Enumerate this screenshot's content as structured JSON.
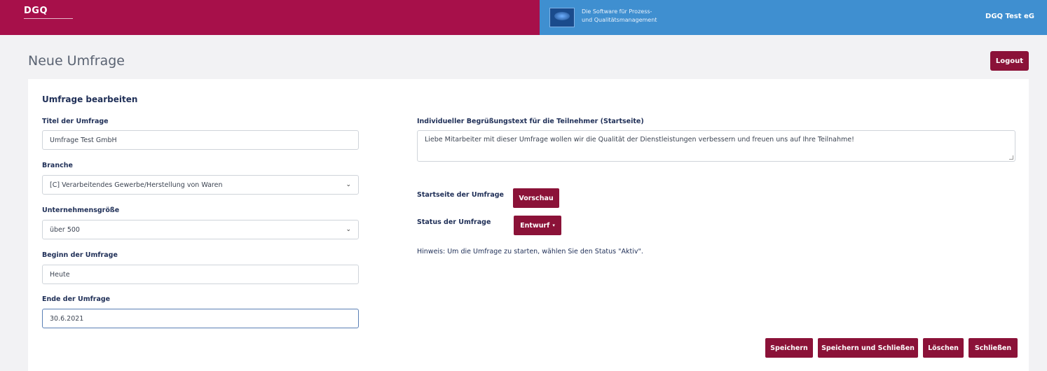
{
  "header": {
    "logo_text": "DGQ",
    "partner_line1": "Die Software für Prozess-",
    "partner_line2": "und Qualitätsmanagement",
    "company": "DGQ Test eG"
  },
  "page": {
    "title": "Neue Umfrage",
    "logout_label": "Logout"
  },
  "form": {
    "section_title": "Umfrage bearbeiten",
    "title_label": "Titel der Umfrage",
    "title_value": "Umfrage Test GmbH",
    "branch_label": "Branche",
    "branch_value": "[C] Verarbeitendes Gewerbe/Herstellung von Waren",
    "size_label": "Unternehmensgröße",
    "size_value": "über 500",
    "start_label": "Beginn der Umfrage",
    "start_value": "Heute",
    "end_label": "Ende der Umfrage",
    "end_value": "30.6.2021",
    "welcome_label": "Individueller Begrüßungstext für die Teilnehmer (Startseite)",
    "welcome_value": "Liebe Mitarbeiter mit dieser Umfrage wollen wir die Qualität der Dienstleistungen verbessern und freuen uns auf Ihre Teilnahme!",
    "startpage_label": "Startseite der Umfrage",
    "preview_label": "Vorschau",
    "status_label": "Status der Umfrage",
    "status_value": "Entwurf",
    "hint": "Hinweis: Um die Umfrage zu starten, wählen Sie den Status \"Aktiv\"."
  },
  "actions": {
    "save": "Speichern",
    "save_close": "Speichern und Schließen",
    "delete": "Löschen",
    "close": "Schließen"
  },
  "colors": {
    "brand": "#a7104a",
    "partner": "#3f8fd0",
    "button": "#8b1238"
  }
}
